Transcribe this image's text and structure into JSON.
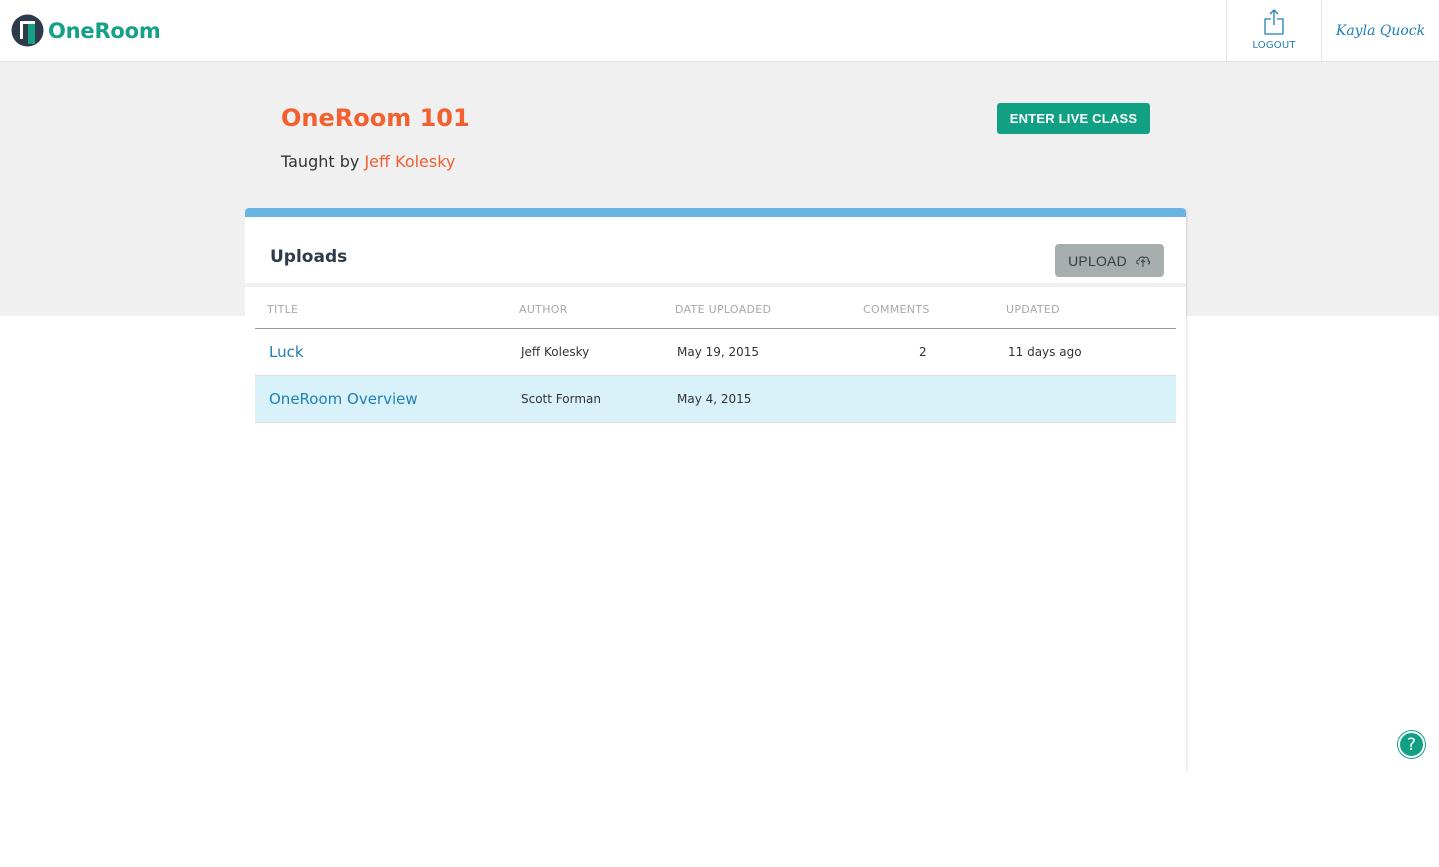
{
  "brand": {
    "name": "OneRoom",
    "color": "#15a087"
  },
  "nav": {
    "logout_label": "LOGOUT",
    "logout_icon": "share-upload-icon",
    "username": "Kayla Quock"
  },
  "course": {
    "title": "OneRoom 101",
    "taught_by_prefix": "Taught by",
    "teacher": "Jeff Kolesky",
    "enter_button": "ENTER LIVE CLASS"
  },
  "uploads": {
    "title": "Uploads",
    "upload_button": "UPLOAD",
    "upload_icon": "cloud-upload-icon",
    "columns": [
      "TITLE",
      "AUTHOR",
      "DATE UPLOADED",
      "COMMENTS",
      "UPDATED"
    ],
    "rows": [
      {
        "title": "Luck",
        "author": "Jeff Kolesky",
        "date": "May 19, 2015",
        "comments": "2",
        "updated": "11 days ago"
      },
      {
        "title": "OneRoom Overview",
        "author": "Scott Forman",
        "date": "May 4, 2015",
        "comments": "",
        "updated": ""
      }
    ]
  },
  "help": {
    "symbol": "?",
    "icon": "help-icon"
  },
  "colors": {
    "accent_orange": "#f26030",
    "accent_teal": "#12a085",
    "link_blue": "#1f7fb6",
    "card_top": "#6ab4e4",
    "row_highlight": "#d9f2f9"
  }
}
